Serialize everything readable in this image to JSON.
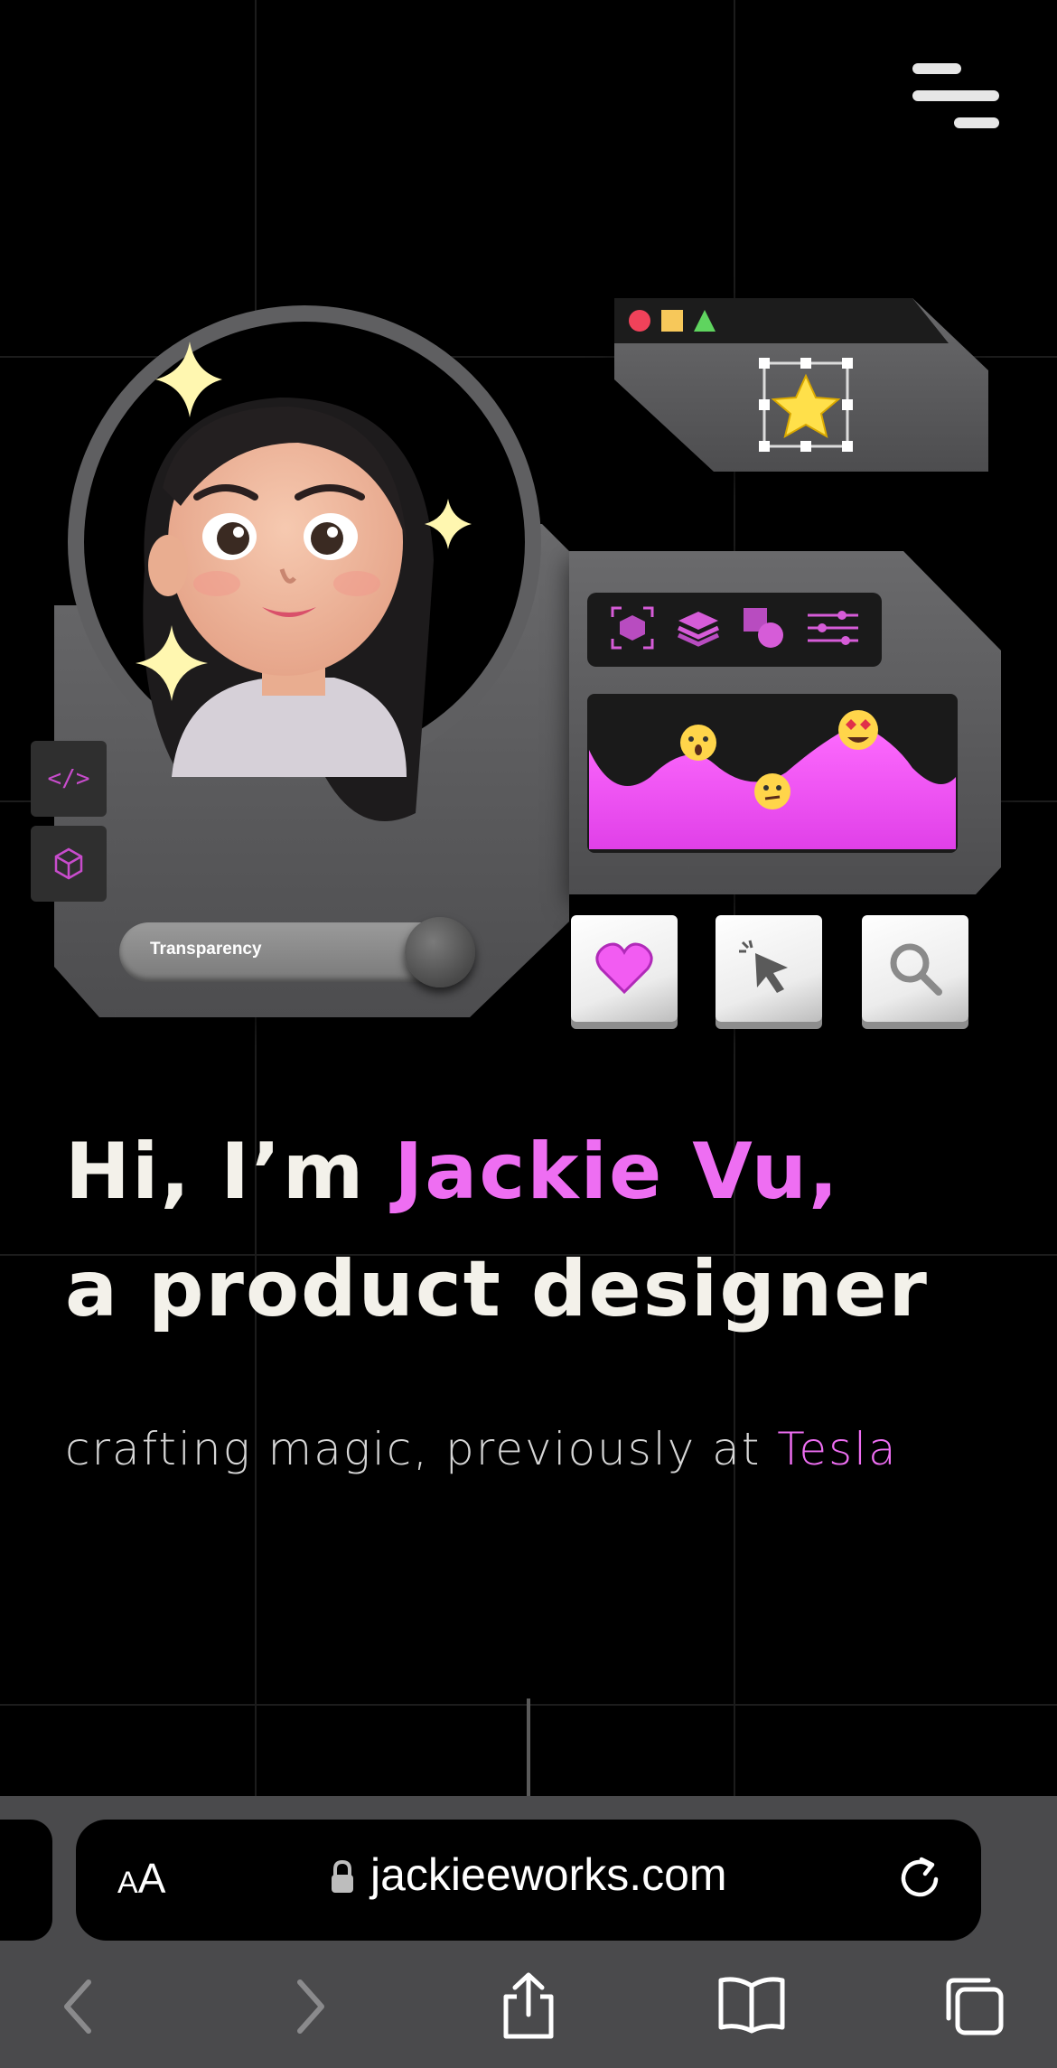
{
  "header": {
    "menu_icon": "hamburger-menu-icon"
  },
  "hero": {
    "slider_label": "Transparency",
    "toolbar_icons": [
      "frame-icon",
      "layers-icon",
      "shapes-icon",
      "sliders-icon"
    ],
    "side_buttons": [
      "code-icon",
      "cube-icon"
    ],
    "tool_tiles": [
      "heart-icon",
      "cursor-icon",
      "search-icon"
    ],
    "window_dots": [
      "red-circle",
      "yellow-square",
      "green-triangle"
    ],
    "colors": {
      "accent": "#ee6ef2",
      "panel": "#5c5c5c",
      "star": "#ffe04a"
    }
  },
  "intro": {
    "greeting": "Hi, I’m ",
    "name": "Jackie Vu,",
    "role": "a product designer",
    "tagline": "crafting magic, previously at ",
    "company": "Tesla"
  },
  "browser": {
    "text_size_label_small": "A",
    "text_size_label_large": "A",
    "url": "jackieeworks.com",
    "nav_icons": [
      "back-icon",
      "forward-icon",
      "share-icon",
      "bookmarks-icon",
      "tabs-icon"
    ]
  }
}
